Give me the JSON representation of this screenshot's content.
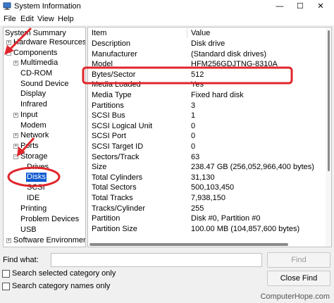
{
  "window": {
    "title": "System Information",
    "controls": [
      "—",
      "☐",
      "✕"
    ]
  },
  "menu": [
    "File",
    "Edit",
    "View",
    "Help"
  ],
  "tree": {
    "system_summary": "System Summary",
    "hardware_resources": "Hardware Resources",
    "components": "Components",
    "multimedia": "Multimedia",
    "cdrom": "CD-ROM",
    "sound_device": "Sound Device",
    "display": "Display",
    "infrared": "Infrared",
    "input": "Input",
    "modem": "Modem",
    "network": "Network",
    "ports": "Ports",
    "storage": "Storage",
    "drives": "Drives",
    "disks": "Disks",
    "scsi": "SCSI",
    "ide": "IDE",
    "printing": "Printing",
    "problem_devices": "Problem Devices",
    "usb": "USB",
    "software_environment": "Software Environment"
  },
  "details": {
    "header": {
      "item": "Item",
      "value": "Value"
    },
    "rows": [
      {
        "item": "Description",
        "value": "Disk drive"
      },
      {
        "item": "Manufacturer",
        "value": "(Standard disk drives)"
      },
      {
        "item": "Model",
        "value": "HFM256GDJTNG-8310A"
      },
      {
        "item": "Bytes/Sector",
        "value": "512"
      },
      {
        "item": "Media Loaded",
        "value": "Yes"
      },
      {
        "item": "Media Type",
        "value": "Fixed hard disk"
      },
      {
        "item": "Partitions",
        "value": "3"
      },
      {
        "item": "SCSI Bus",
        "value": "1"
      },
      {
        "item": "SCSI Logical Unit",
        "value": "0"
      },
      {
        "item": "SCSI Port",
        "value": "0"
      },
      {
        "item": "SCSI Target ID",
        "value": "0"
      },
      {
        "item": "Sectors/Track",
        "value": "63"
      },
      {
        "item": "Size",
        "value": "238.47 GB (256,052,966,400 bytes)"
      },
      {
        "item": "Total Cylinders",
        "value": "31,130"
      },
      {
        "item": "Total Sectors",
        "value": "500,103,450"
      },
      {
        "item": "Total Tracks",
        "value": "7,938,150"
      },
      {
        "item": "Tracks/Cylinder",
        "value": "255"
      },
      {
        "item": "Partition",
        "value": "Disk #0, Partition #0"
      },
      {
        "item": "Partition Size",
        "value": "100.00 MB (104,857,600 bytes)"
      }
    ]
  },
  "find": {
    "label": "Find what:",
    "value": "",
    "find_button": "Find",
    "close_find_button": "Close Find",
    "search_selected": "Search selected category only",
    "search_names": "Search category names only"
  },
  "watermark": "ComputerHope.com",
  "colors": {
    "annotation_red": "#e0262b",
    "selection_blue": "#0a58d0"
  }
}
